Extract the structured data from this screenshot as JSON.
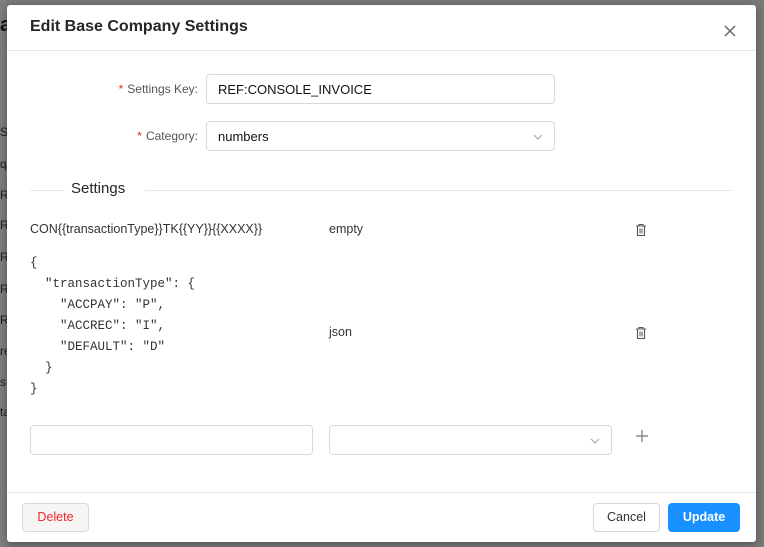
{
  "modal": {
    "title": "Edit Base Company Settings"
  },
  "form": {
    "settings_key": {
      "label": "Settings Key:",
      "value": "REF:CONSOLE_INVOICE"
    },
    "category": {
      "label": "Category:",
      "value": "numbers"
    }
  },
  "settings": {
    "heading": "Settings",
    "rows": [
      {
        "key": "CON{{transactionType}}TK{{YY}}{{XXXX}}",
        "type": "empty"
      },
      {
        "key": "{\n  \"transactionType\": {\n    \"ACCPAY\": \"P\",\n    \"ACCREC\": \"I\",\n    \"DEFAULT\": \"D\"\n  }\n}",
        "type": "json"
      }
    ],
    "new_row": {
      "key_value": "",
      "type_value": ""
    }
  },
  "footer": {
    "delete_label": "Delete",
    "cancel_label": "Cancel",
    "update_label": "Update"
  },
  "colors": {
    "primary": "#1890ff",
    "danger": "#f5222d",
    "required": "#f5222d"
  },
  "icons": {
    "close": "close-icon",
    "chevron": "chevron-down-icon",
    "trash": "trash-icon",
    "plus": "plus-icon"
  }
}
